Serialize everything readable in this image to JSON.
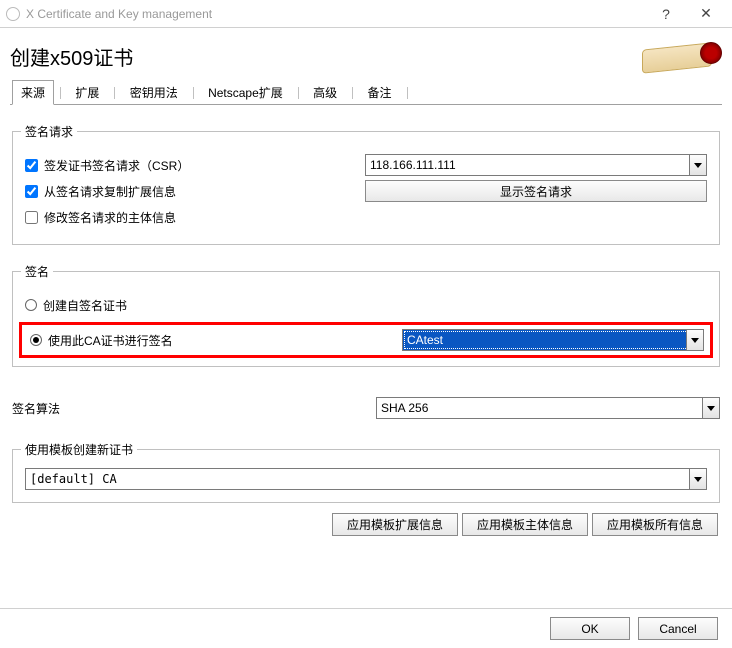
{
  "window": {
    "title": "X Certificate and Key management"
  },
  "heading": "创建x509证书",
  "tabs": {
    "source": "来源",
    "extensions": "扩展",
    "keyusage": "密钥用法",
    "netscape": "Netscape扩展",
    "advanced": "高级",
    "comment": "备注"
  },
  "group_request": {
    "legend": "签名请求",
    "csr_label": "签发证书签名请求（CSR）",
    "csr_checked": true,
    "copy_ext_label": "从签名请求复制扩展信息",
    "copy_ext_checked": true,
    "modify_subject_label": "修改签名请求的主体信息",
    "modify_subject_checked": false,
    "ip_value": "118.166.111.111",
    "show_request_btn": "显示签名请求"
  },
  "group_sign": {
    "legend": "签名",
    "self_sign_label": "创建自签名证书",
    "ca_sign_label": "使用此CA证书进行签名",
    "ca_value": "CAtest",
    "selected": "ca"
  },
  "algo": {
    "label": "签名算法",
    "value": "SHA 256"
  },
  "group_template": {
    "legend": "使用模板创建新证书",
    "value": "[default] CA",
    "btn_ext": "应用模板扩展信息",
    "btn_subject": "应用模板主体信息",
    "btn_all": "应用模板所有信息"
  },
  "buttons": {
    "ok": "OK",
    "cancel": "Cancel"
  }
}
